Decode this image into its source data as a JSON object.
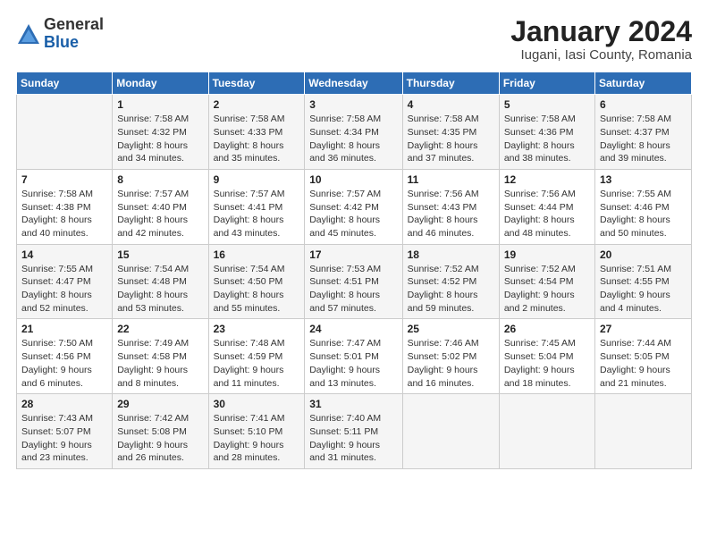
{
  "logo": {
    "general": "General",
    "blue": "Blue"
  },
  "header": {
    "title": "January 2024",
    "location": "Iugani, Iasi County, Romania"
  },
  "days": [
    "Sunday",
    "Monday",
    "Tuesday",
    "Wednesday",
    "Thursday",
    "Friday",
    "Saturday"
  ],
  "weeks": [
    [
      {
        "num": "",
        "sunrise": "",
        "sunset": "",
        "daylight": ""
      },
      {
        "num": "1",
        "sunrise": "Sunrise: 7:58 AM",
        "sunset": "Sunset: 4:32 PM",
        "daylight": "Daylight: 8 hours and 34 minutes."
      },
      {
        "num": "2",
        "sunrise": "Sunrise: 7:58 AM",
        "sunset": "Sunset: 4:33 PM",
        "daylight": "Daylight: 8 hours and 35 minutes."
      },
      {
        "num": "3",
        "sunrise": "Sunrise: 7:58 AM",
        "sunset": "Sunset: 4:34 PM",
        "daylight": "Daylight: 8 hours and 36 minutes."
      },
      {
        "num": "4",
        "sunrise": "Sunrise: 7:58 AM",
        "sunset": "Sunset: 4:35 PM",
        "daylight": "Daylight: 8 hours and 37 minutes."
      },
      {
        "num": "5",
        "sunrise": "Sunrise: 7:58 AM",
        "sunset": "Sunset: 4:36 PM",
        "daylight": "Daylight: 8 hours and 38 minutes."
      },
      {
        "num": "6",
        "sunrise": "Sunrise: 7:58 AM",
        "sunset": "Sunset: 4:37 PM",
        "daylight": "Daylight: 8 hours and 39 minutes."
      }
    ],
    [
      {
        "num": "7",
        "sunrise": "Sunrise: 7:58 AM",
        "sunset": "Sunset: 4:38 PM",
        "daylight": "Daylight: 8 hours and 40 minutes."
      },
      {
        "num": "8",
        "sunrise": "Sunrise: 7:57 AM",
        "sunset": "Sunset: 4:40 PM",
        "daylight": "Daylight: 8 hours and 42 minutes."
      },
      {
        "num": "9",
        "sunrise": "Sunrise: 7:57 AM",
        "sunset": "Sunset: 4:41 PM",
        "daylight": "Daylight: 8 hours and 43 minutes."
      },
      {
        "num": "10",
        "sunrise": "Sunrise: 7:57 AM",
        "sunset": "Sunset: 4:42 PM",
        "daylight": "Daylight: 8 hours and 45 minutes."
      },
      {
        "num": "11",
        "sunrise": "Sunrise: 7:56 AM",
        "sunset": "Sunset: 4:43 PM",
        "daylight": "Daylight: 8 hours and 46 minutes."
      },
      {
        "num": "12",
        "sunrise": "Sunrise: 7:56 AM",
        "sunset": "Sunset: 4:44 PM",
        "daylight": "Daylight: 8 hours and 48 minutes."
      },
      {
        "num": "13",
        "sunrise": "Sunrise: 7:55 AM",
        "sunset": "Sunset: 4:46 PM",
        "daylight": "Daylight: 8 hours and 50 minutes."
      }
    ],
    [
      {
        "num": "14",
        "sunrise": "Sunrise: 7:55 AM",
        "sunset": "Sunset: 4:47 PM",
        "daylight": "Daylight: 8 hours and 52 minutes."
      },
      {
        "num": "15",
        "sunrise": "Sunrise: 7:54 AM",
        "sunset": "Sunset: 4:48 PM",
        "daylight": "Daylight: 8 hours and 53 minutes."
      },
      {
        "num": "16",
        "sunrise": "Sunrise: 7:54 AM",
        "sunset": "Sunset: 4:50 PM",
        "daylight": "Daylight: 8 hours and 55 minutes."
      },
      {
        "num": "17",
        "sunrise": "Sunrise: 7:53 AM",
        "sunset": "Sunset: 4:51 PM",
        "daylight": "Daylight: 8 hours and 57 minutes."
      },
      {
        "num": "18",
        "sunrise": "Sunrise: 7:52 AM",
        "sunset": "Sunset: 4:52 PM",
        "daylight": "Daylight: 8 hours and 59 minutes."
      },
      {
        "num": "19",
        "sunrise": "Sunrise: 7:52 AM",
        "sunset": "Sunset: 4:54 PM",
        "daylight": "Daylight: 9 hours and 2 minutes."
      },
      {
        "num": "20",
        "sunrise": "Sunrise: 7:51 AM",
        "sunset": "Sunset: 4:55 PM",
        "daylight": "Daylight: 9 hours and 4 minutes."
      }
    ],
    [
      {
        "num": "21",
        "sunrise": "Sunrise: 7:50 AM",
        "sunset": "Sunset: 4:56 PM",
        "daylight": "Daylight: 9 hours and 6 minutes."
      },
      {
        "num": "22",
        "sunrise": "Sunrise: 7:49 AM",
        "sunset": "Sunset: 4:58 PM",
        "daylight": "Daylight: 9 hours and 8 minutes."
      },
      {
        "num": "23",
        "sunrise": "Sunrise: 7:48 AM",
        "sunset": "Sunset: 4:59 PM",
        "daylight": "Daylight: 9 hours and 11 minutes."
      },
      {
        "num": "24",
        "sunrise": "Sunrise: 7:47 AM",
        "sunset": "Sunset: 5:01 PM",
        "daylight": "Daylight: 9 hours and 13 minutes."
      },
      {
        "num": "25",
        "sunrise": "Sunrise: 7:46 AM",
        "sunset": "Sunset: 5:02 PM",
        "daylight": "Daylight: 9 hours and 16 minutes."
      },
      {
        "num": "26",
        "sunrise": "Sunrise: 7:45 AM",
        "sunset": "Sunset: 5:04 PM",
        "daylight": "Daylight: 9 hours and 18 minutes."
      },
      {
        "num": "27",
        "sunrise": "Sunrise: 7:44 AM",
        "sunset": "Sunset: 5:05 PM",
        "daylight": "Daylight: 9 hours and 21 minutes."
      }
    ],
    [
      {
        "num": "28",
        "sunrise": "Sunrise: 7:43 AM",
        "sunset": "Sunset: 5:07 PM",
        "daylight": "Daylight: 9 hours and 23 minutes."
      },
      {
        "num": "29",
        "sunrise": "Sunrise: 7:42 AM",
        "sunset": "Sunset: 5:08 PM",
        "daylight": "Daylight: 9 hours and 26 minutes."
      },
      {
        "num": "30",
        "sunrise": "Sunrise: 7:41 AM",
        "sunset": "Sunset: 5:10 PM",
        "daylight": "Daylight: 9 hours and 28 minutes."
      },
      {
        "num": "31",
        "sunrise": "Sunrise: 7:40 AM",
        "sunset": "Sunset: 5:11 PM",
        "daylight": "Daylight: 9 hours and 31 minutes."
      },
      {
        "num": "",
        "sunrise": "",
        "sunset": "",
        "daylight": ""
      },
      {
        "num": "",
        "sunrise": "",
        "sunset": "",
        "daylight": ""
      },
      {
        "num": "",
        "sunrise": "",
        "sunset": "",
        "daylight": ""
      }
    ]
  ]
}
